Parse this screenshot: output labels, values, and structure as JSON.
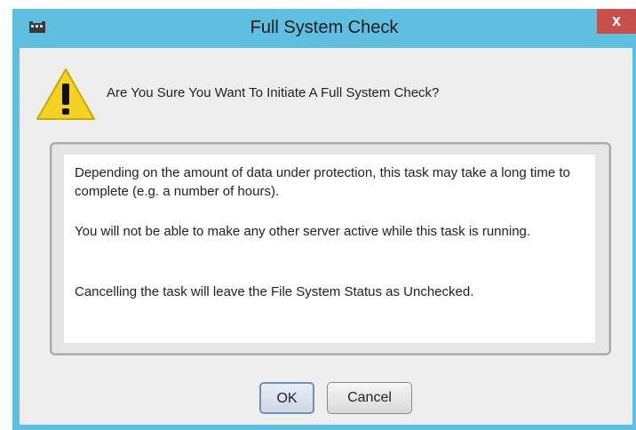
{
  "window": {
    "title": "Full System Check",
    "close_label": "x"
  },
  "dialog": {
    "question": "Are You Sure You Want To Initiate A Full System Check?",
    "message": [
      "Depending on the amount of data under protection, this task may take a long time to complete (e.g. a number of hours).",
      "You will not be able to make any other server active while this task is running.",
      "Cancelling the task will leave the File System Status as Unchecked."
    ]
  },
  "buttons": {
    "ok_label": "OK",
    "cancel_label": "Cancel"
  },
  "icons": {
    "app": "app-icon",
    "warning": "warning-icon",
    "close": "close-icon"
  },
  "colors": {
    "titlebar": "#5fbfe0",
    "close_button": "#c7504a",
    "warning_fill": "#f4d21f"
  }
}
